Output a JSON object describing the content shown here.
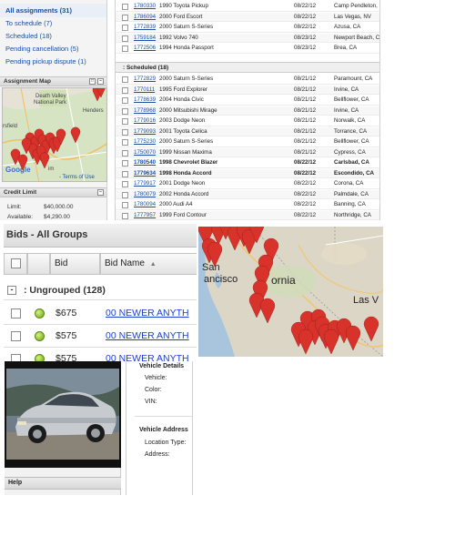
{
  "sidebar": {
    "links": [
      {
        "label": "All assignments (31)"
      },
      {
        "label": "To schedule (7)"
      },
      {
        "label": "Scheduled (18)"
      },
      {
        "label": "Pending cancellation (5)"
      },
      {
        "label": "Pending pickup dispute (1)"
      }
    ],
    "assignment_map_title": "Assignment Map",
    "map_labels": {
      "death_valley": "Death Valley",
      "national_park": "National Park",
      "hendersen": "Henders",
      "sfield": "rsfield",
      "google": "Google",
      "terms": "- Terms of Use",
      "im": "im"
    },
    "credit_limit_title": "Credit Limit",
    "credit": [
      {
        "label": "Limit:",
        "value": "$40,000.00"
      },
      {
        "label": "Available:",
        "value": "$4,290.00"
      }
    ]
  },
  "assignments": {
    "top_rows": [
      {
        "num": "1780330",
        "vehicle": "1990 Toyota Pickup",
        "date": "08/22/12",
        "location": "Camp Pendleton,"
      },
      {
        "num": "1786094",
        "vehicle": "2000 Ford Escort",
        "date": "08/22/12",
        "location": "Las Vegas, NV"
      },
      {
        "num": "1772839",
        "vehicle": "2000 Saturn S-Series",
        "date": "08/22/12",
        "location": "Azusa, CA"
      },
      {
        "num": "1759184",
        "vehicle": "1992 Volvo 740",
        "date": "08/23/12",
        "location": "Newport Beach, C"
      },
      {
        "num": "1772506",
        "vehicle": "1994 Honda Passport",
        "date": "08/23/12",
        "location": "Brea, CA"
      }
    ],
    "scheduled_header": ": Scheduled (18)",
    "scheduled_rows": [
      {
        "num": "1772829",
        "vehicle": "2000 Saturn S-Series",
        "date": "08/21/12",
        "location": "Paramount, CA",
        "bold": false
      },
      {
        "num": "1770111",
        "vehicle": "1995 Ford Explorer",
        "date": "08/21/12",
        "location": "Irvine, CA",
        "bold": false
      },
      {
        "num": "1778639",
        "vehicle": "2004 Honda Civic",
        "date": "08/21/12",
        "location": "Bellflower, CA",
        "bold": false
      },
      {
        "num": "1778968",
        "vehicle": "2000 Mitsubishi Mirage",
        "date": "08/21/12",
        "location": "Irvine, CA",
        "bold": false
      },
      {
        "num": "1779016",
        "vehicle": "2003 Dodge Neon",
        "date": "08/21/12",
        "location": "Norwalk, CA",
        "bold": false
      },
      {
        "num": "1779093",
        "vehicle": "2001 Toyota Celica",
        "date": "08/21/12",
        "location": "Torrance, CA",
        "bold": false
      },
      {
        "num": "1775230",
        "vehicle": "2000 Saturn S-Series",
        "date": "08/21/12",
        "location": "Bellflower, CA",
        "bold": false
      },
      {
        "num": "1750070",
        "vehicle": "1999 Nissan Maxima",
        "date": "08/21/12",
        "location": "Cypress, CA",
        "bold": false
      },
      {
        "num": "1780540",
        "vehicle": "1998 Chevrolet Blazer",
        "date": "08/22/12",
        "location": "Carlsbad, CA",
        "bold": true
      },
      {
        "num": "1779634",
        "vehicle": "1998 Honda Accord",
        "date": "08/22/12",
        "location": "Escondido, CA",
        "bold": true
      },
      {
        "num": "1779917",
        "vehicle": "2001 Dodge Neon",
        "date": "08/22/12",
        "location": "Corona, CA",
        "bold": false
      },
      {
        "num": "1780079",
        "vehicle": "2002 Honda Accord",
        "date": "08/22/12",
        "location": "Palmdale, CA",
        "bold": false
      },
      {
        "num": "1780094",
        "vehicle": "2000 Audi A4",
        "date": "08/22/12",
        "location": "Banning, CA",
        "bold": false
      },
      {
        "num": "1777957",
        "vehicle": "1999 Ford Contour",
        "date": "08/22/12",
        "location": "Northridge, CA",
        "bold": false
      }
    ]
  },
  "bids": {
    "title": "Bids - All Groups",
    "col_bid": "Bid",
    "col_bid_name": "Bid Name",
    "sort_indicator": "▲",
    "group_label": ": Ungrouped (128)",
    "rows": [
      {
        "amount": "$675",
        "name": "00 NEWER ANYTH"
      },
      {
        "amount": "$575",
        "name": "00 NEWER ANYTH"
      },
      {
        "amount": "$575",
        "name": "00 NEWER ANYTH"
      }
    ]
  },
  "big_map": {
    "labels": {
      "san_francisco_1": "San",
      "san_francisco_2": "ancisco",
      "california": "ornia",
      "las_vegas": "Las V"
    }
  },
  "vehicle": {
    "details_title": "Vehicle Details",
    "fields": [
      {
        "label": "Vehicle:"
      },
      {
        "label": "Color:"
      },
      {
        "label": "VIN:"
      }
    ],
    "address_title": "Vehicle Address",
    "address_fields": [
      {
        "label": "Location Type:"
      },
      {
        "label": "Address:"
      }
    ],
    "help_title": "Help"
  },
  "colors": {
    "link": "#1a4fa3",
    "pin": "#d9322b",
    "bid_link": "#1a3fd1",
    "status_green": "#6ba318"
  }
}
